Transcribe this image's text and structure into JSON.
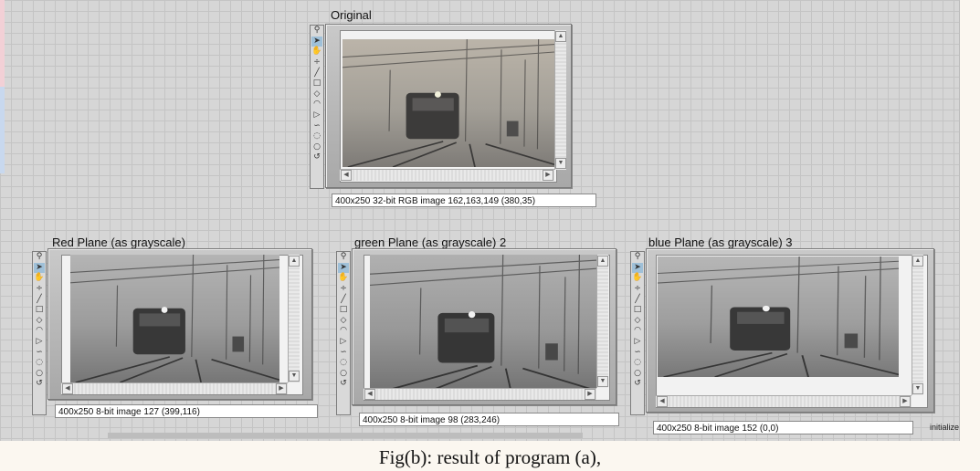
{
  "tools": [
    {
      "name": "zoom-tool",
      "glyph": "⚲"
    },
    {
      "name": "pointer-tool",
      "glyph": "➤"
    },
    {
      "name": "pan-tool",
      "glyph": "✋"
    },
    {
      "name": "point-tool",
      "glyph": "÷"
    },
    {
      "name": "line-tool",
      "glyph": "╱"
    },
    {
      "name": "rectangle-tool",
      "glyph": "□"
    },
    {
      "name": "rotated-rectangle-tool",
      "glyph": "◇"
    },
    {
      "name": "annulus-tool",
      "glyph": "◠"
    },
    {
      "name": "polygon-tool",
      "glyph": "▷"
    },
    {
      "name": "freehand-line-tool",
      "glyph": "∽"
    },
    {
      "name": "freehand-region-tool",
      "glyph": "◌"
    },
    {
      "name": "oval-tool",
      "glyph": "○"
    },
    {
      "name": "broken-line-tool",
      "glyph": "↺"
    }
  ],
  "panels": {
    "original": {
      "label": "Original",
      "status": "400x250 32-bit RGB image 162,163,149    (380,35)"
    },
    "red": {
      "label": "Red Plane (as grayscale)",
      "status": "400x250 8-bit image 127    (399,116)"
    },
    "green": {
      "label": "green Plane (as grayscale) 2",
      "status": "400x250 8-bit image 98    (283,246)"
    },
    "blue": {
      "label": "blue Plane (as grayscale) 3",
      "status": "400x250 8-bit image 152    (0,0)"
    }
  },
  "edge_text": "initialize",
  "caption": "Fig(b): result of program (a),",
  "colors": {
    "canvas": "#d6d6d6",
    "grid": "#c4c4c4",
    "page": "#fbf7f0",
    "selected_tool": "#9fc0d8"
  }
}
